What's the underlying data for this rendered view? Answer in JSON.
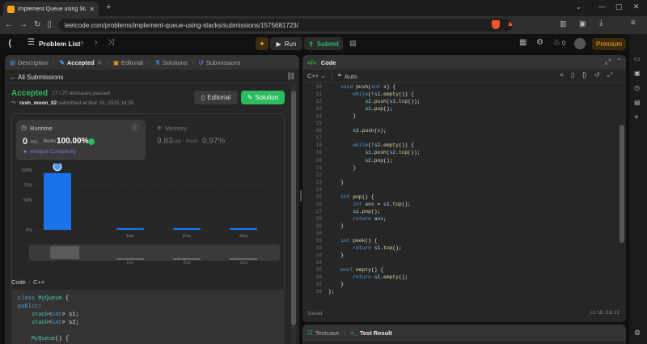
{
  "browser": {
    "tab_title": "Implement Queue using Stacks",
    "url": "leetcode.com/problems/implement-queue-using-stacks/submissions/1575681723/"
  },
  "nav": {
    "problem_list": "Problem List",
    "run": "Run",
    "submit": "Submit",
    "fire_count": "0",
    "premium": "Premium"
  },
  "left_tabs": {
    "description": "Description",
    "accepted": "Accepted",
    "editorial": "Editorial",
    "solutions": "Solutions",
    "submissions": "Submissions"
  },
  "submission": {
    "back": "All Submissions",
    "status": "Accepted",
    "testcases": "27 / 27 testcases passed",
    "user": "rush_moon_02",
    "submitted": "submitted at Mar 16, 2025 18:55",
    "editorial_btn": "Editorial",
    "solution_btn": "Solution"
  },
  "runtime": {
    "label": "Runtime",
    "value": "0",
    "unit": "ms",
    "beats_label": "Beats",
    "beats": "100.00%",
    "analyze": "Analyze Complexity"
  },
  "memory": {
    "label": "Memory",
    "value": "9.83",
    "unit": "MB",
    "beats_label": "Beats",
    "beats": "0.97%"
  },
  "chart_data": {
    "type": "bar",
    "categories": [
      "",
      "1ms",
      "2ms",
      "3ms"
    ],
    "values": [
      95,
      3,
      3,
      3
    ],
    "ylim": [
      0,
      100
    ],
    "yticks": [
      "100%",
      "75%",
      "50%",
      "0%"
    ],
    "mini_labels": [
      "1ms",
      "2ms",
      "3ms"
    ],
    "accent": "#1a73e8"
  },
  "code_section": {
    "label": "Code",
    "lang": "C++",
    "lines": [
      "class MyQueue {",
      "public:",
      "    stack<int> s1;",
      "    stack<int> s2;",
      "",
      "    MyQueue() {"
    ]
  },
  "editor": {
    "title": "Code",
    "lang": "C++",
    "mode": "Auto",
    "saved": "Saved",
    "cursor": "Ln 18, Col 22",
    "start_line": 10,
    "lines": [
      "    void push(int x) {",
      "        while(!s1.empty()) {",
      "            s2.push(s1.top());",
      "            s1.pop();",
      "        }",
      "",
      "        s1.push(x);",
      "",
      "        while(!s2.empty()) {",
      "            s1.push(s2.top());",
      "            s2.pop();",
      "        }",
      "",
      "    }",
      "",
      "    int pop() {",
      "        int ans = s1.top();",
      "        s1.pop();",
      "        return ans;",
      "    }",
      "",
      "    int peek() {",
      "        return s1.top();",
      "    }",
      "",
      "    bool empty() {",
      "        return s1.empty();",
      "    }",
      "};"
    ]
  },
  "bottom": {
    "testcase": "Testcase",
    "result": "Test Result"
  },
  "colors": {
    "accepted": "#2cbb5d",
    "beats": "#2cbb5d",
    "premium": "#ffa116"
  }
}
